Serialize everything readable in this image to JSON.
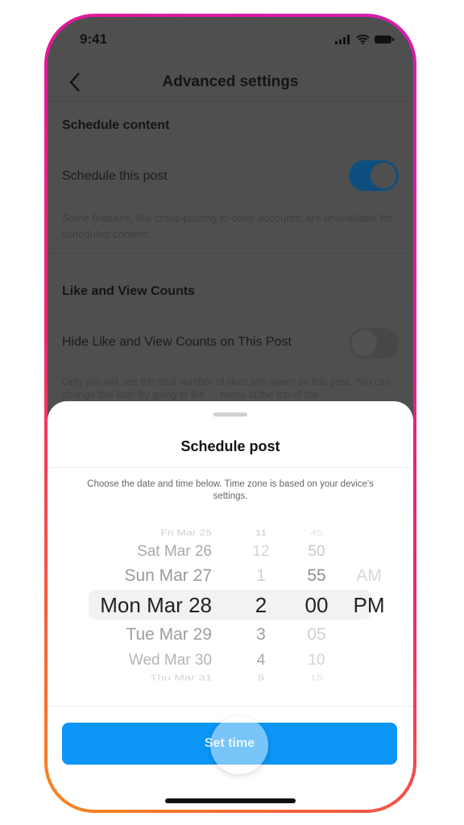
{
  "status_bar": {
    "time": "9:41",
    "icons": [
      "signal-icon",
      "wifi-icon",
      "battery-icon"
    ]
  },
  "header": {
    "title": "Advanced settings",
    "back_icon": "chevron-left-icon"
  },
  "sections": [
    {
      "heading": "Schedule content",
      "row_label": "Schedule this post",
      "toggle_on": true,
      "description": "Some features, like cross-posting to other accounts, are unavailable for scheduled content."
    },
    {
      "heading": "Like and View Counts",
      "row_label": "Hide Like and View Counts on This Post",
      "toggle_on": false,
      "description": "Only you will see the total number of likes and views on this post. You can change this later by going to the ··· menu at the top of the"
    }
  ],
  "sheet": {
    "title": "Schedule post",
    "subtitle": "Choose the date and time below. Time zone is based on your device's settings.",
    "picker": {
      "dates": [
        "Fri Mar 25",
        "Sat Mar 26",
        "Sun Mar 27",
        "Mon Mar 28",
        "Tue Mar 29",
        "Wed Mar 30",
        "Thu Mar 31"
      ],
      "hours": [
        "11",
        "12",
        "1",
        "2",
        "3",
        "4",
        "5"
      ],
      "minutes": [
        "45",
        "50",
        "55",
        "00",
        "05",
        "10",
        "15"
      ],
      "periods": [
        "",
        "",
        "AM",
        "PM",
        "",
        "",
        ""
      ],
      "selected": {
        "date": "Mon Mar 28",
        "hour": "2",
        "minute": "00",
        "period": "PM"
      }
    },
    "button_label": "Set time"
  },
  "colors": {
    "accent": "#0b95f6",
    "toggle_on": "#0d4f7e",
    "frame_gradient": [
      "#f7891e",
      "#d21fb0"
    ]
  }
}
